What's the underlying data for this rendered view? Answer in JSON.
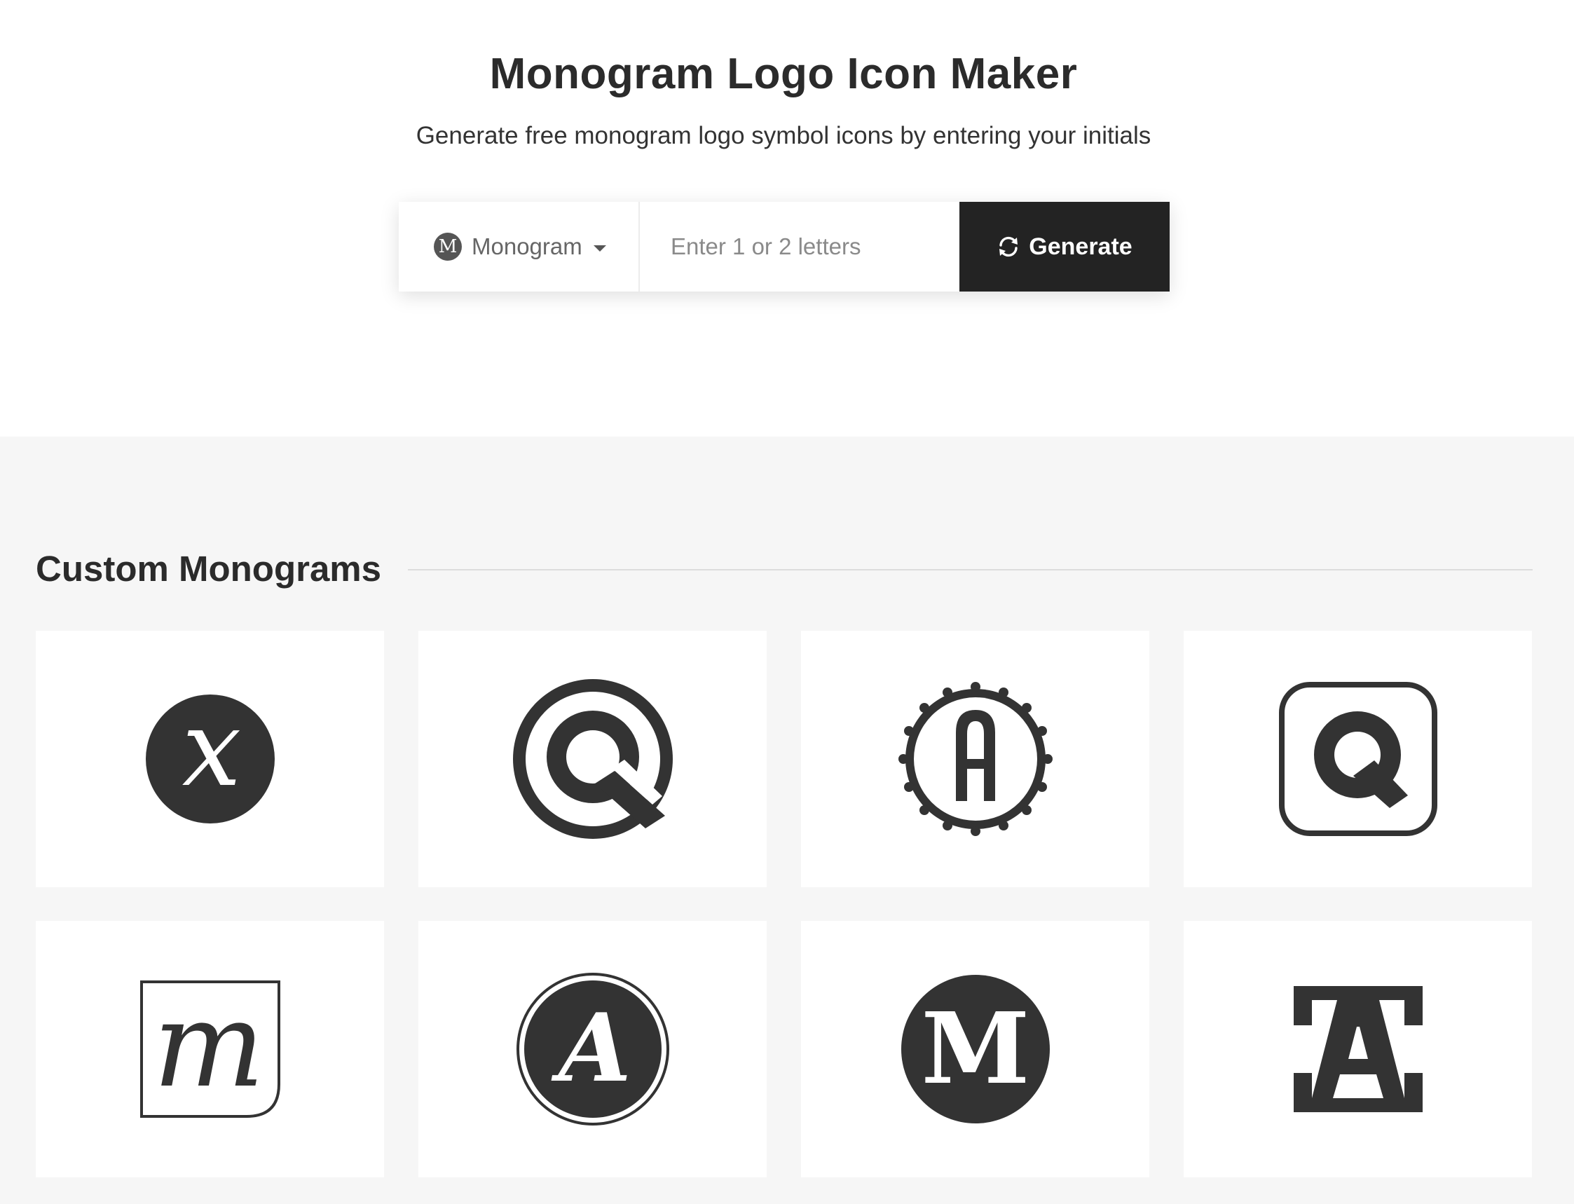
{
  "header": {
    "title": "Monogram Logo Icon Maker",
    "subtitle": "Generate free monogram logo symbol icons by entering your initials"
  },
  "search": {
    "style_badge": "M",
    "style_label": "Monogram",
    "input_value": "",
    "placeholder": "Enter 1 or 2 letters",
    "generate_label": "Generate",
    "generate_icon": "refresh-icon"
  },
  "gallery": {
    "heading": "Custom Monograms",
    "cards": [
      {
        "letter": "x",
        "style": "italic script in solid circle"
      },
      {
        "letter": "Q",
        "style": "letter inside thick ring"
      },
      {
        "letter": "A",
        "style": "condensed letter in scalloped seal"
      },
      {
        "letter": "Q",
        "style": "letter in rounded square outline"
      },
      {
        "letter": "m",
        "style": "italic script in leaf-corner square"
      },
      {
        "letter": "A",
        "style": "italic script in double-ring circle"
      },
      {
        "letter": "M",
        "style": "slab serif in solid circle"
      },
      {
        "letter": "A",
        "style": "knockout letter in bracket square"
      }
    ]
  },
  "colors": {
    "ink": "#333333",
    "button_bg": "#232323",
    "gallery_bg": "#f6f6f6"
  }
}
